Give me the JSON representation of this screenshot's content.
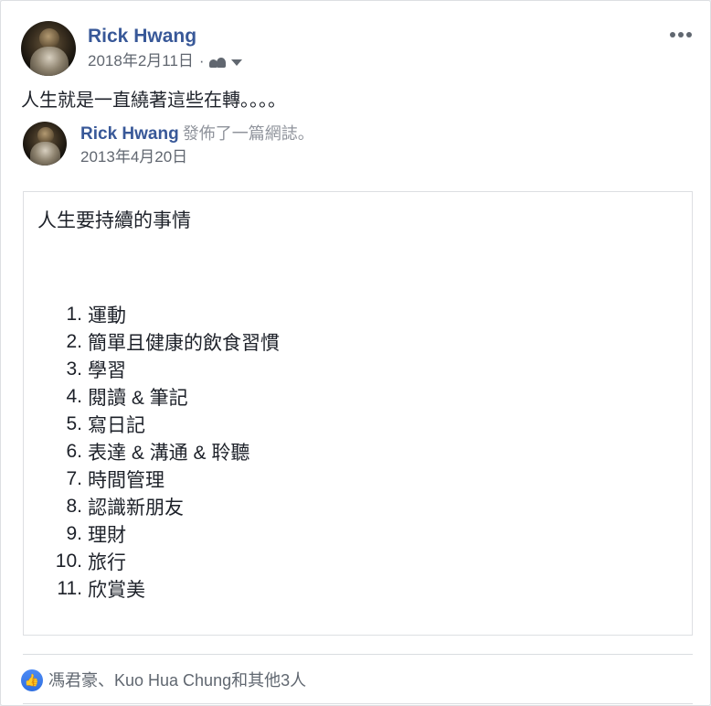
{
  "post": {
    "author": "Rick Hwang",
    "date": "2018年2月11日",
    "separator": "·",
    "text": "人生就是一直繞著這些在轉。。。。"
  },
  "shared": {
    "author": "Rick Hwang",
    "action": "發佈了一篇網誌。",
    "date": "2013年4月20日"
  },
  "note": {
    "title": "人生要持續的事情",
    "items": [
      {
        "num": "1.",
        "label": "運動"
      },
      {
        "num": "2.",
        "label": "簡單且健康的飲食習慣"
      },
      {
        "num": "3.",
        "label": "學習"
      },
      {
        "num": "4.",
        "label": "閱讀 & 筆記"
      },
      {
        "num": "5.",
        "label": "寫日記"
      },
      {
        "num": "6.",
        "label": "表達 & 溝通 & 聆聽"
      },
      {
        "num": "7.",
        "label": "時間管理"
      },
      {
        "num": "8.",
        "label": "認識新朋友"
      },
      {
        "num": "9.",
        "label": "理財"
      },
      {
        "num": "10.",
        "label": "旅行"
      },
      {
        "num": "11.",
        "label": "欣賞美"
      }
    ]
  },
  "reactions": {
    "text": "馮君豪、Kuo Hua Chung和其他3人",
    "icon": "thumbs-up-icon",
    "icon_glyph": "👍"
  },
  "colors": {
    "link": "#385898",
    "meta": "#616770",
    "like": "#2f6fe0"
  }
}
